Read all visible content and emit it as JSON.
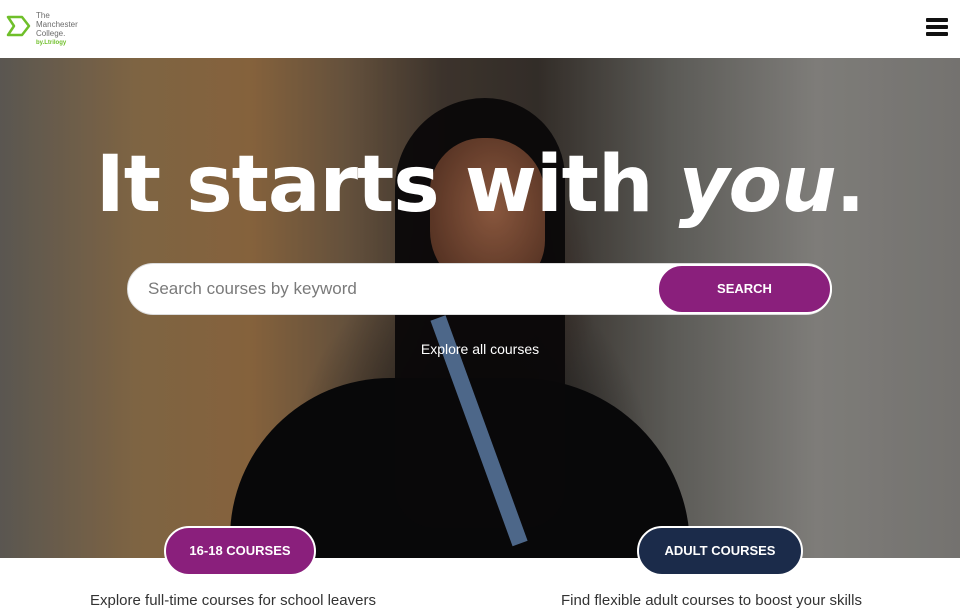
{
  "header": {
    "logo_line1": "The",
    "logo_line2": "Manchester",
    "logo_line3": "College.",
    "logo_sub": "by.Ltrilogy",
    "menu_icon": "hamburger-menu-icon"
  },
  "hero": {
    "headline_main": "It starts with ",
    "headline_emph": "you",
    "headline_end": "."
  },
  "search": {
    "placeholder": "Search courses by keyword",
    "value": "",
    "button_label": "SEARCH"
  },
  "explore_link": "Explore all courses",
  "courses": {
    "left_label": "16-18 COURSES",
    "right_label": "ADULT COURSES",
    "left_desc": "Explore full-time courses for school leavers",
    "right_desc": "Find flexible adult courses to boost your skills"
  },
  "colors": {
    "accent_purple": "#8a1f7c",
    "accent_navy": "#1b2b4a",
    "logo_green": "#6fbf2a"
  }
}
